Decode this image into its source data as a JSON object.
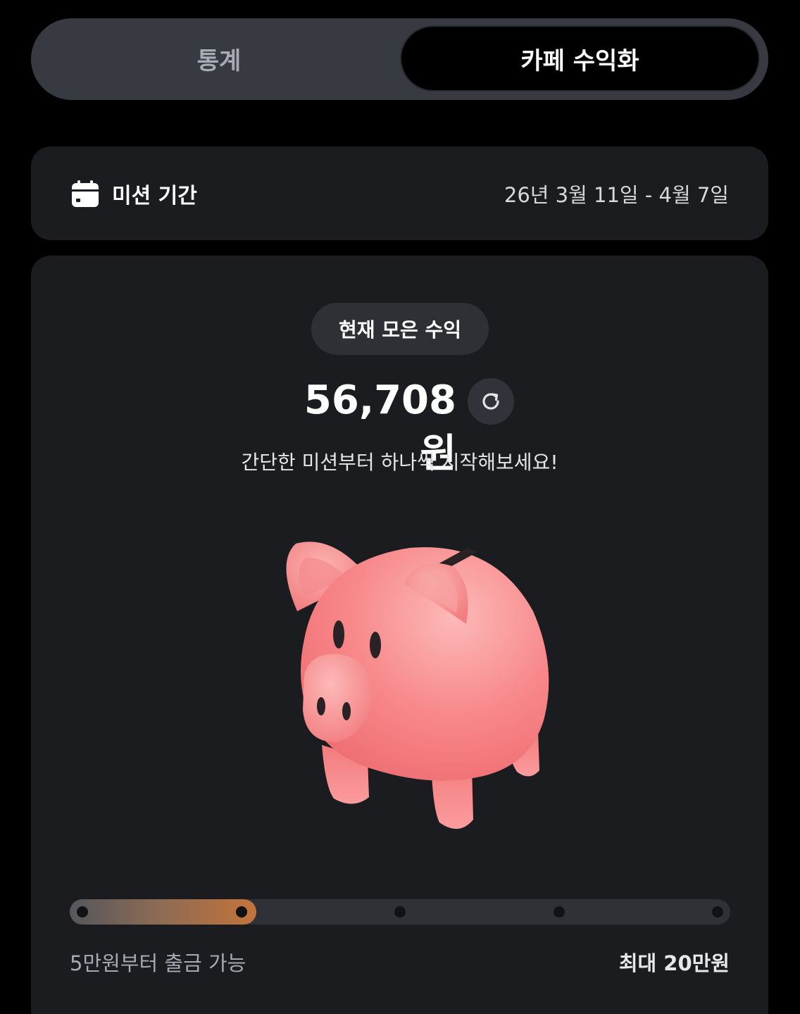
{
  "tabs": {
    "stats_label": "통계",
    "monetize_label": "카페 수익화",
    "active": "카페 수익화"
  },
  "period": {
    "icon": "calendar-icon",
    "label": "미션 기간",
    "range": "26년 3월 11일 - 4월 7일"
  },
  "earnings": {
    "pill_label": "현재 모은 수익",
    "amount": "56,708원",
    "refresh_icon": "refresh-icon",
    "subtitle": "간단한 미션부터 하나씩 시작해보세요!",
    "image": "piggy-bank-illustration"
  },
  "progress": {
    "fill_fraction": 0.283,
    "milestones": 5,
    "min_label": "5만원부터 출금 가능",
    "max_label": "최대 20만원",
    "fill_color_start": "#55565c",
    "fill_color_end": "#c4743a"
  },
  "colors": {
    "background": "#000000",
    "card": "#1b1c20",
    "tab_track": "#373a41",
    "piggy_pink": "#f7868a"
  }
}
